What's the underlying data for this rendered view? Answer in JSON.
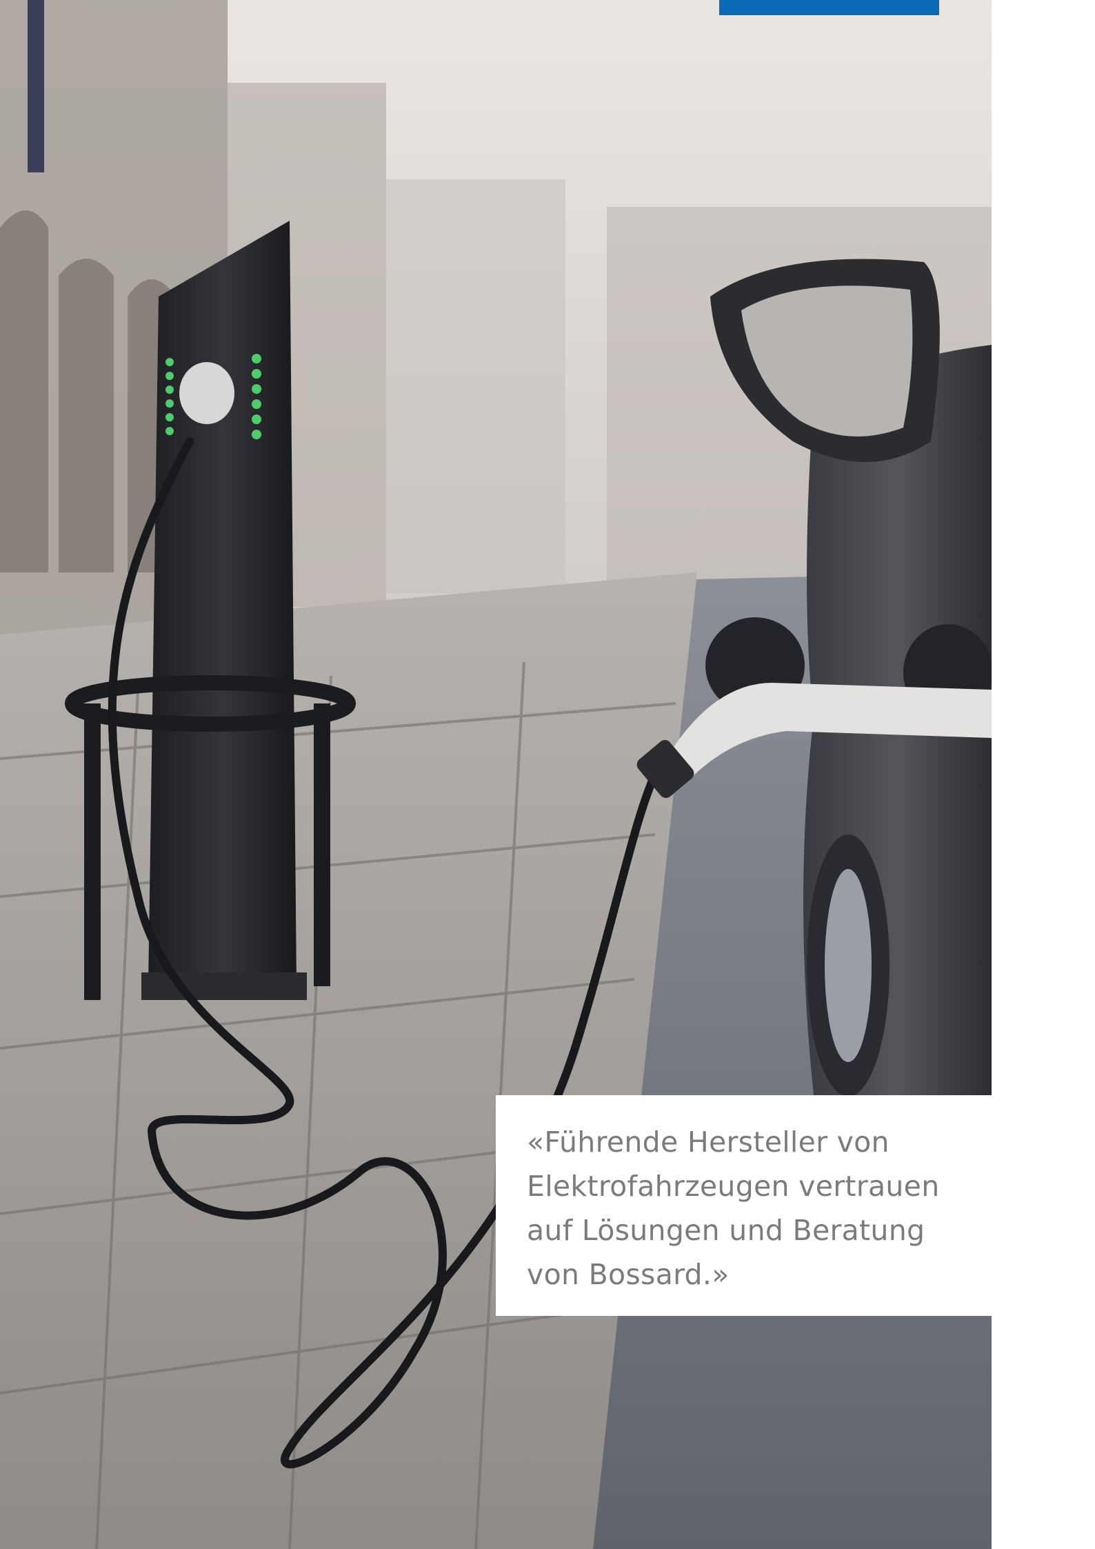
{
  "photo": {
    "subject": "electric-car-charging-station-image"
  },
  "quote": {
    "lines": [
      "«Führende Hersteller von",
      "Elektrofahrzeugen vertrauen",
      "auf Lösungen und Beratung",
      "von Bossard.»"
    ]
  },
  "colors": {
    "accent": "#0a6ab8",
    "quote_text": "#7b7b7b"
  }
}
